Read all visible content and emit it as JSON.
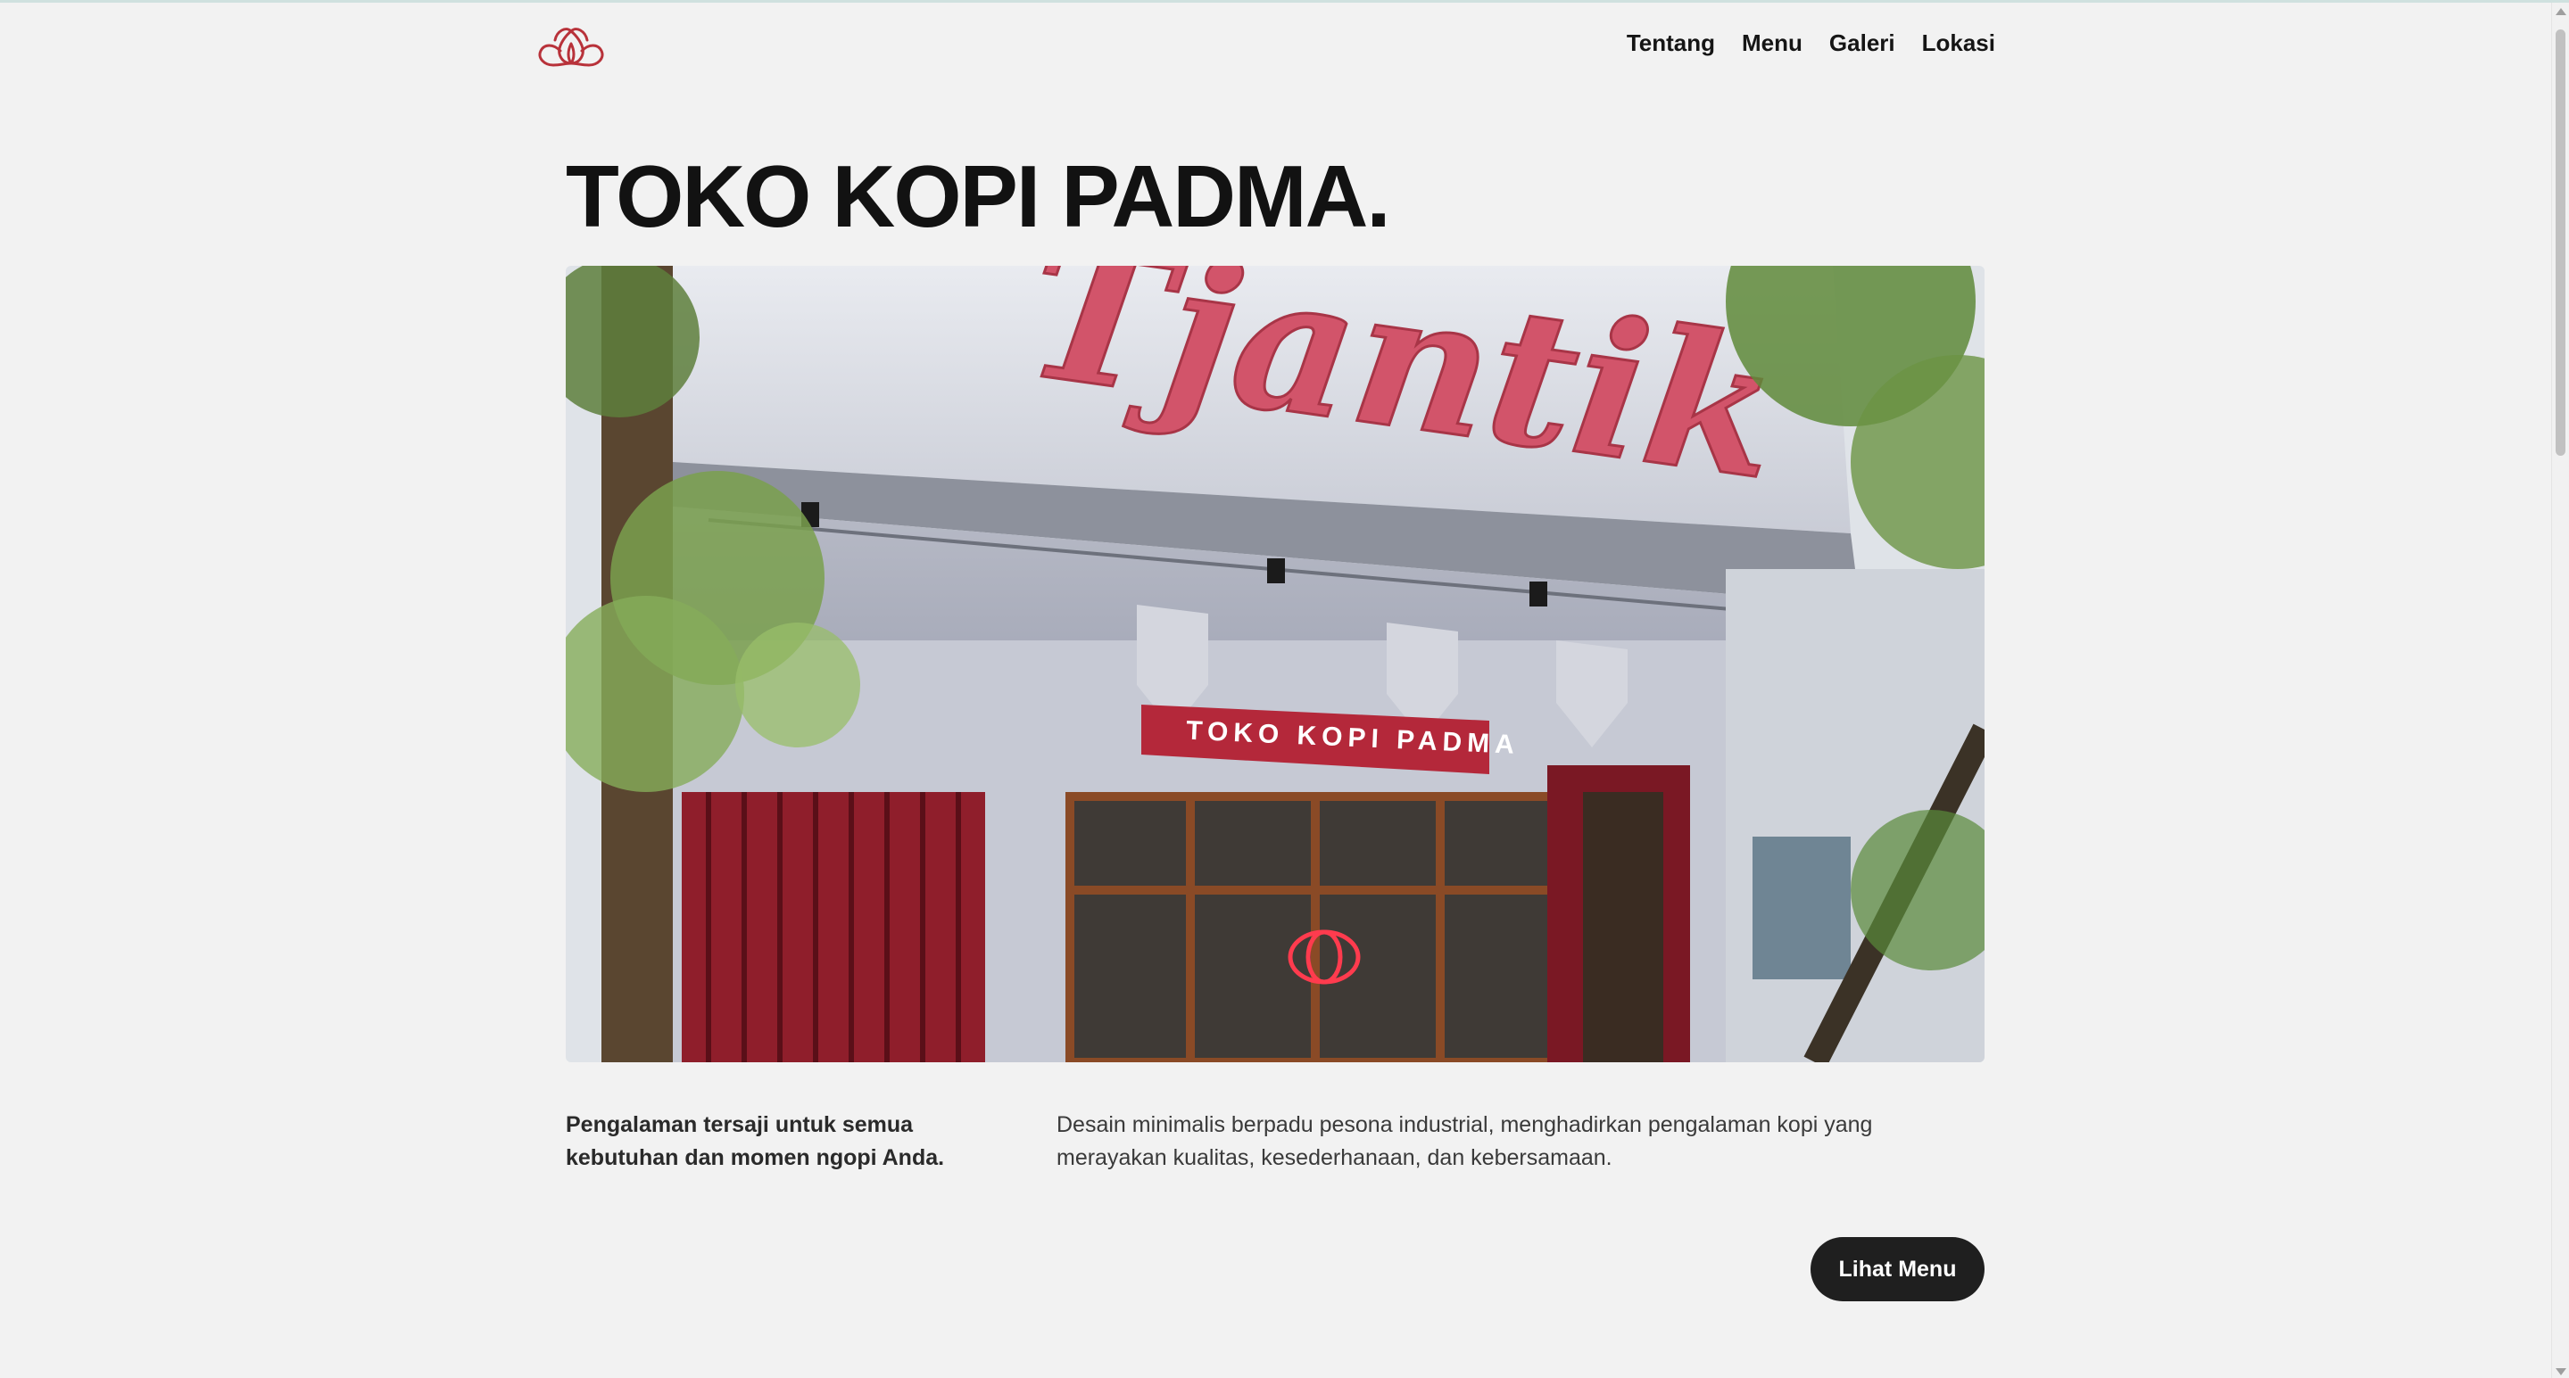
{
  "nav": {
    "logo_icon": "lotus-logo-icon",
    "links": [
      "Tentang",
      "Menu",
      "Galeri",
      "Lokasi"
    ]
  },
  "hero": {
    "title": "TOKO KOPI PADMA.",
    "image": {
      "building_sign": "Tjantik",
      "shop_sign": "TOKO KOPI PADMA"
    }
  },
  "intro": {
    "tagline": "Pengalaman tersaji untuk semua kebutuhan dan momen ngopi Anda.",
    "description": "Desain minimalis berpadu pesona industrial, menghadirkan pengalaman kopi yang merayakan kualitas, kesederhanaan, dan kebersamaan."
  },
  "cta": {
    "label": "Lihat Menu"
  },
  "colors": {
    "background": "#f2f2f2",
    "brand_red": "#b8323a",
    "button_bg": "#1f1f1f",
    "text_dark": "#121212"
  }
}
